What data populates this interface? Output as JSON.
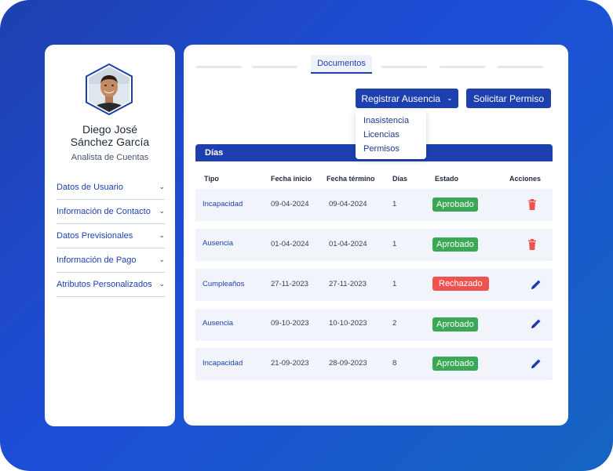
{
  "colors": {
    "primary": "#1e40af",
    "approved": "#3aa854",
    "rejected": "#ef5350",
    "delete": "#ef5350"
  },
  "profile": {
    "name_line1": "Diego José",
    "name_line2": "Sánchez García",
    "role": "Analista de Cuentas"
  },
  "sidebar": {
    "items": [
      {
        "label": "Datos de Usuario",
        "icon": "chevron-down-icon"
      },
      {
        "label": "Información de Contacto",
        "icon": "chevron-down-icon"
      },
      {
        "label": "Datos Previsionales",
        "icon": "chevron-down-icon"
      },
      {
        "label": "Información de Pago",
        "icon": "chevron-down-icon"
      },
      {
        "label": "Atributos Personalizados",
        "icon": "chevron-down-icon"
      }
    ]
  },
  "tabs": {
    "active_label": "Documentos"
  },
  "toolbar": {
    "register_label": "Registrar Ausencia",
    "permission_label": "Solicitar Permiso"
  },
  "dropdown": {
    "options": [
      "Inasistencia",
      "Licencias",
      "Permisos"
    ]
  },
  "table": {
    "title": "Días",
    "columns": [
      "Tipo",
      "Fecha inicio",
      "Fecha término",
      "Días",
      "Estado",
      "Acciones"
    ],
    "rows": [
      {
        "tipo": "Incapacidad",
        "inicio": "09-04-2024",
        "termino": "09-04-2024",
        "dias": "1",
        "estado": "Aprobado",
        "status": "approved",
        "action": "trash-icon"
      },
      {
        "tipo": "Ausencia",
        "inicio": "01-04-2024",
        "termino": "01-04-2024",
        "dias": "1",
        "estado": "Aprobado",
        "status": "approved",
        "action": "trash-icon"
      },
      {
        "tipo": "Cumpleaños",
        "inicio": "27-11-2023",
        "termino": "27-11-2023",
        "dias": "1",
        "estado": "Rechazado",
        "status": "rejected",
        "action": "pencil-icon"
      },
      {
        "tipo": "Ausencia",
        "inicio": "09-10-2023",
        "termino": "10-10-2023",
        "dias": "2",
        "estado": "Aprobado",
        "status": "approved",
        "action": "pencil-icon"
      },
      {
        "tipo": "Incapacidad",
        "inicio": "21-09-2023",
        "termino": "28-09-2023",
        "dias": "8",
        "estado": "Aprobado",
        "status": "approved",
        "action": "pencil-icon"
      }
    ]
  }
}
